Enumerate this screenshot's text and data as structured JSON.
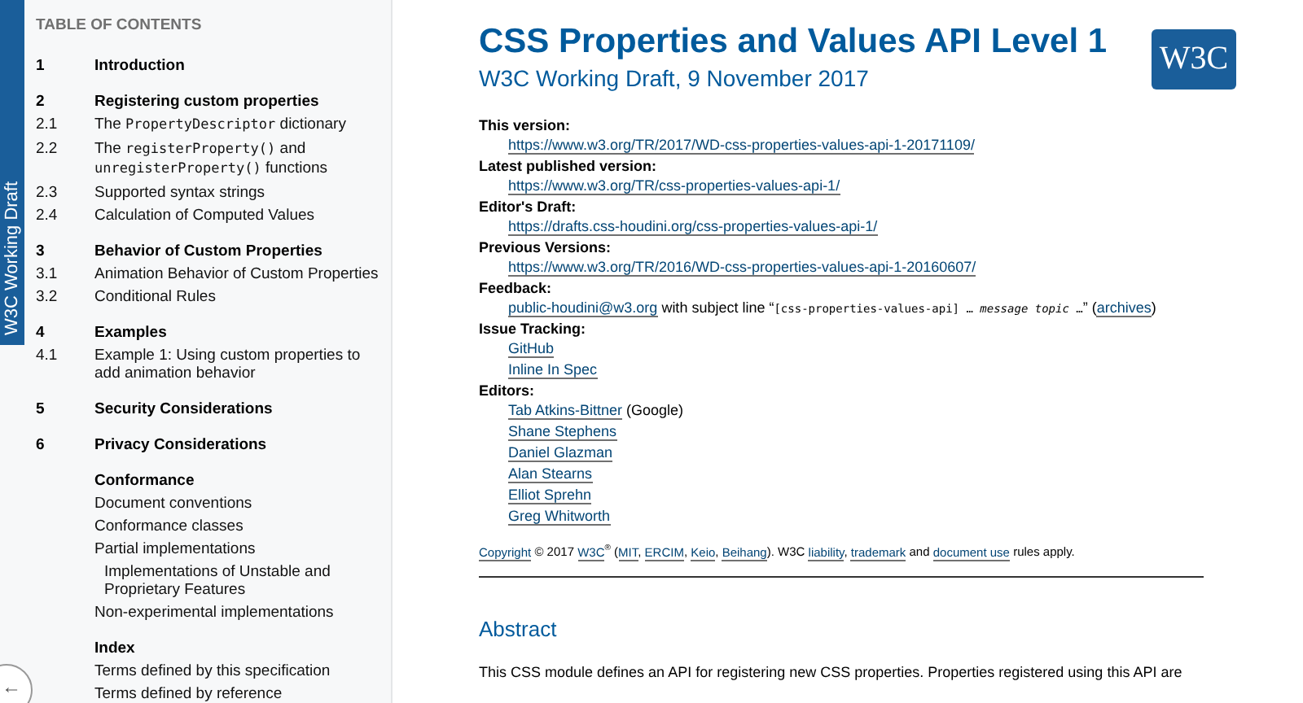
{
  "sidebar": {
    "status_label": "W3C Working Draft",
    "toc_title": "TABLE OF CONTENTS",
    "items": [
      {
        "number": "1",
        "kind": "section",
        "parts": [
          {
            "kind": "text",
            "text": "Introduction"
          }
        ]
      },
      {
        "number": "2",
        "kind": "section",
        "parts": [
          {
            "kind": "text",
            "text": "Registering custom properties"
          }
        ],
        "children": [
          {
            "number": "2.1",
            "kind": "sub",
            "parts": [
              {
                "kind": "text",
                "text": "The "
              },
              {
                "kind": "code",
                "text": "PropertyDescriptor"
              },
              {
                "kind": "text",
                "text": " dictionary"
              }
            ]
          },
          {
            "number": "2.2",
            "kind": "sub",
            "parts": [
              {
                "kind": "text",
                "text": "The "
              },
              {
                "kind": "code",
                "text": "registerProperty()"
              },
              {
                "kind": "text",
                "text": " and "
              },
              {
                "kind": "code",
                "text": "unregisterProperty()"
              },
              {
                "kind": "text",
                "text": " functions"
              }
            ]
          },
          {
            "number": "2.3",
            "kind": "sub",
            "parts": [
              {
                "kind": "text",
                "text": "Supported syntax strings"
              }
            ]
          },
          {
            "number": "2.4",
            "kind": "sub",
            "parts": [
              {
                "kind": "text",
                "text": "Calculation of Computed Values"
              }
            ]
          }
        ]
      },
      {
        "number": "3",
        "kind": "section",
        "parts": [
          {
            "kind": "text",
            "text": "Behavior of Custom Properties"
          }
        ],
        "children": [
          {
            "number": "3.1",
            "kind": "sub",
            "parts": [
              {
                "kind": "text",
                "text": "Animation Behavior of Custom Properties"
              }
            ]
          },
          {
            "number": "3.2",
            "kind": "sub",
            "parts": [
              {
                "kind": "text",
                "text": "Conditional Rules"
              }
            ]
          }
        ]
      },
      {
        "number": "4",
        "kind": "section",
        "parts": [
          {
            "kind": "text",
            "text": "Examples"
          }
        ],
        "children": [
          {
            "number": "4.1",
            "kind": "sub",
            "parts": [
              {
                "kind": "text",
                "text": "Example 1: Using custom properties to add animation behavior"
              }
            ]
          }
        ]
      },
      {
        "number": "5",
        "kind": "section",
        "parts": [
          {
            "kind": "text",
            "text": "Security Considerations"
          }
        ]
      },
      {
        "number": "6",
        "kind": "section",
        "parts": [
          {
            "kind": "text",
            "text": "Privacy Considerations"
          }
        ]
      },
      {
        "kind": "section",
        "parts": [
          {
            "kind": "text",
            "text": "Conformance"
          }
        ],
        "children": [
          {
            "kind": "sub",
            "parts": [
              {
                "kind": "text",
                "text": "Document conventions"
              }
            ]
          },
          {
            "kind": "sub",
            "parts": [
              {
                "kind": "text",
                "text": "Conformance classes"
              }
            ]
          },
          {
            "kind": "sub",
            "parts": [
              {
                "kind": "text",
                "text": "Partial implementations"
              }
            ],
            "children": [
              {
                "kind": "sub",
                "parts": [
                  {
                    "kind": "text",
                    "text": "Implementations of Unstable and Proprietary Features"
                  }
                ]
              }
            ]
          },
          {
            "kind": "sub",
            "parts": [
              {
                "kind": "text",
                "text": "Non-experimental implementations"
              }
            ]
          }
        ]
      },
      {
        "kind": "section",
        "parts": [
          {
            "kind": "text",
            "text": "Index"
          }
        ],
        "children": [
          {
            "kind": "sub",
            "parts": [
              {
                "kind": "text",
                "text": "Terms defined by this specification"
              }
            ]
          },
          {
            "kind": "sub",
            "parts": [
              {
                "kind": "text",
                "text": "Terms defined by reference"
              }
            ]
          }
        ]
      }
    ],
    "back_button": "←"
  },
  "header": {
    "title": "CSS Properties and Values API Level 1",
    "subtitle": "W3C Working Draft, 9 November 2017",
    "logo": "W3C"
  },
  "metadata": [
    {
      "label": "This version:",
      "values": [
        [
          {
            "kind": "link",
            "text": "https://www.w3.org/TR/2017/WD-css-properties-values-api-1-20171109/"
          }
        ]
      ]
    },
    {
      "label": "Latest published version:",
      "values": [
        [
          {
            "kind": "link",
            "text": "https://www.w3.org/TR/css-properties-values-api-1/"
          }
        ]
      ]
    },
    {
      "label": "Editor's Draft:",
      "values": [
        [
          {
            "kind": "link",
            "text": "https://drafts.css-houdini.org/css-properties-values-api-1/"
          }
        ]
      ]
    },
    {
      "label": "Previous Versions:",
      "values": [
        [
          {
            "kind": "link",
            "text": "https://www.w3.org/TR/2016/WD-css-properties-values-api-1-20160607/"
          }
        ]
      ]
    },
    {
      "label": "Feedback:",
      "values": [
        [
          {
            "kind": "link",
            "text": "public-houdini@w3.org"
          },
          {
            "kind": "text",
            "text": " with subject line “"
          },
          {
            "kind": "code",
            "text": "[css-properties-values-api] … "
          },
          {
            "kind": "codeitalic",
            "text": "message topic"
          },
          {
            "kind": "code",
            "text": " …"
          },
          {
            "kind": "text",
            "text": "” ("
          },
          {
            "kind": "link",
            "text": "archives"
          },
          {
            "kind": "text",
            "text": ")"
          }
        ]
      ]
    },
    {
      "label": "Issue Tracking:",
      "values": [
        [
          {
            "kind": "link",
            "text": "GitHub"
          }
        ],
        [
          {
            "kind": "link",
            "text": "Inline In Spec"
          }
        ]
      ]
    },
    {
      "label": "Editors:",
      "values": [
        [
          {
            "kind": "link",
            "text": "Tab Atkins-Bittner"
          },
          {
            "kind": "text",
            "text": " (Google)"
          }
        ],
        [
          {
            "kind": "link",
            "text": "Shane Stephens"
          }
        ],
        [
          {
            "kind": "link",
            "text": "Daniel Glazman"
          }
        ],
        [
          {
            "kind": "link",
            "text": "Alan Stearns"
          }
        ],
        [
          {
            "kind": "link",
            "text": "Elliot Sprehn"
          }
        ],
        [
          {
            "kind": "link",
            "text": "Greg Whitworth"
          }
        ]
      ]
    }
  ],
  "copyright": [
    {
      "kind": "link",
      "text": "Copyright"
    },
    {
      "kind": "text",
      "text": " © 2017 "
    },
    {
      "kind": "link",
      "text": "W3C"
    },
    {
      "kind": "sup",
      "text": "®"
    },
    {
      "kind": "text",
      "text": " ("
    },
    {
      "kind": "link",
      "text": "MIT"
    },
    {
      "kind": "text",
      "text": ", "
    },
    {
      "kind": "link",
      "text": "ERCIM"
    },
    {
      "kind": "text",
      "text": ", "
    },
    {
      "kind": "link",
      "text": "Keio"
    },
    {
      "kind": "text",
      "text": ", "
    },
    {
      "kind": "link",
      "text": "Beihang"
    },
    {
      "kind": "text",
      "text": "). W3C "
    },
    {
      "kind": "link",
      "text": "liability"
    },
    {
      "kind": "text",
      "text": ", "
    },
    {
      "kind": "link",
      "text": "trademark"
    },
    {
      "kind": "text",
      "text": " and "
    },
    {
      "kind": "link",
      "text": "document use"
    },
    {
      "kind": "text",
      "text": " rules apply."
    }
  ],
  "abstract": {
    "heading": "Abstract",
    "text": "This CSS module defines an API for registering new CSS properties. Properties registered using this API are"
  }
}
